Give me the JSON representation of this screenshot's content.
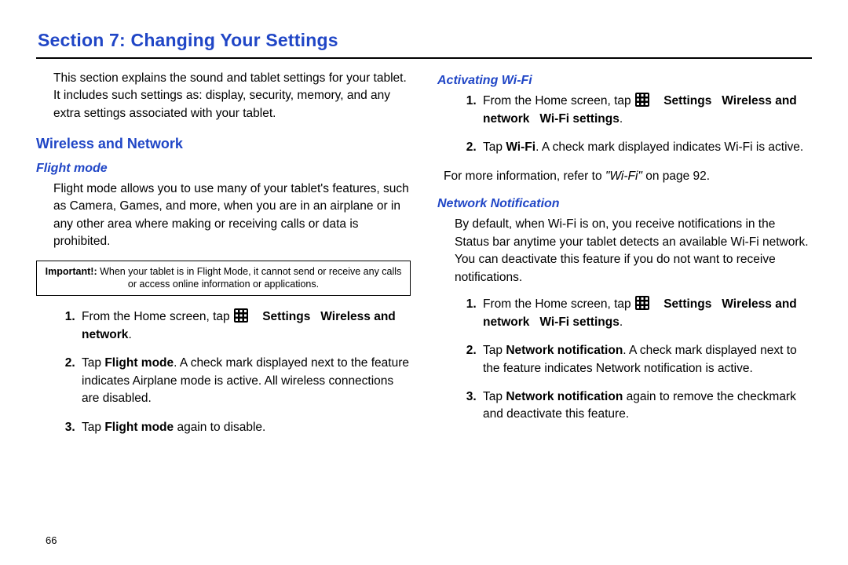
{
  "section_title": "Section 7: Changing Your Settings",
  "page_number": "66",
  "intro": "This section explains the sound and tablet settings for your tablet. It includes such settings as: display, security, memory, and any extra settings associated with your tablet.",
  "wireless_heading": "Wireless and Network",
  "flight": {
    "heading": "Flight mode",
    "para": "Flight mode allows you to use many of your tablet's features, such as Camera, Games, and more, when you are in an airplane or in any other area where making or receiving calls or data is prohibited.",
    "important_label": "Important!:",
    "important_text": " When your tablet is in Flight Mode, it cannot send or receive any calls or access online information or applications.",
    "step1_a": "From the Home screen, tap ",
    "step1_b": "Settings",
    "step1_c": "Wireless and network",
    "step2_a": "Tap ",
    "step2_b": "Flight mode",
    "step2_c": ". A check mark displayed next to the feature indicates Airplane mode is active. All wireless connections are disabled.",
    "step3_a": "Tap ",
    "step3_b": "Flight mode",
    "step3_c": " again to disable."
  },
  "wifi": {
    "heading": "Activating Wi-Fi",
    "step1_a": "From the Home screen, tap ",
    "step1_b": "Settings",
    "step1_c": "Wireless and network",
    "step1_d": "Wi-Fi settings",
    "step2_a": "Tap ",
    "step2_b": "Wi-Fi",
    "step2_c": ". A check mark displayed indicates Wi-Fi is active.",
    "ref_a": "For more information, refer to ",
    "ref_b": "\"Wi-Fi\"",
    "ref_c": " on page 92."
  },
  "net": {
    "heading": "Network Notification",
    "para": "By default, when Wi-Fi is on, you receive notifications in the Status bar anytime your tablet detects an available Wi-Fi network. You can deactivate this feature if you do not want to receive notifications.",
    "step1_a": "From the Home screen, tap ",
    "step1_b": "Settings",
    "step1_c": "Wireless and network",
    "step1_d": "Wi-Fi settings",
    "step2_a": "Tap ",
    "step2_b": "Network notification",
    "step2_c": ". A check mark displayed next to the feature indicates Network notification is active.",
    "step3_a": "Tap ",
    "step3_b": "Network notification",
    "step3_c": " again to remove the checkmark and deactivate this feature."
  }
}
